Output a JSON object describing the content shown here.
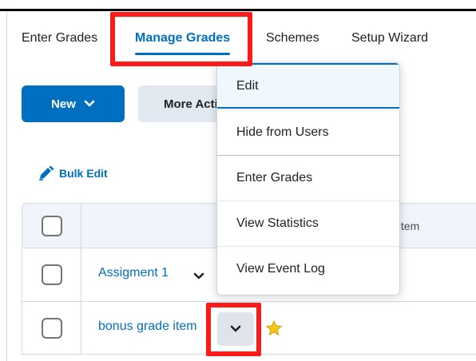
{
  "tabs": [
    {
      "label": "Enter Grades"
    },
    {
      "label": "Manage Grades",
      "active": true
    },
    {
      "label": "Schemes"
    },
    {
      "label": "Setup Wizard"
    }
  ],
  "toolbar": {
    "new_label": "New",
    "more_actions_label": "More Actions"
  },
  "bulk_edit_label": "Bulk Edit",
  "table": {
    "header_item_label": "Item",
    "rows": [
      {
        "name": "Assigment 1"
      },
      {
        "name": "bonus grade item"
      }
    ]
  },
  "menu": {
    "items": [
      {
        "label": "Edit"
      },
      {
        "label": "Hide from Users"
      },
      {
        "label": "Enter Grades"
      },
      {
        "label": "View Statistics"
      },
      {
        "label": "View Event Log"
      }
    ]
  },
  "colors": {
    "accent": "#006fbf",
    "highlight": "#ff1a1a",
    "secondary_button": "#e3e9f1",
    "star": "#f5c518"
  },
  "icons": {
    "new_chevron": "chevron-down-icon",
    "bulk_edit": "pencil-icon",
    "row_chevron": "chevron-down-icon",
    "bonus_marker": "star-icon"
  }
}
